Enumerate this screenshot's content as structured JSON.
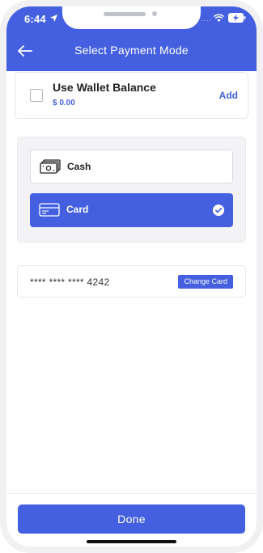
{
  "status_bar": {
    "time": "6:44",
    "icons": [
      "location-arrow-icon",
      "wifi-icon",
      "battery-charging-icon"
    ]
  },
  "header": {
    "title": "Select Payment Mode",
    "back_icon": "arrow-left-icon"
  },
  "wallet": {
    "label": "Use Wallet Balance",
    "amount": "$ 0.00",
    "add_label": "Add",
    "checked": false
  },
  "payment_methods": [
    {
      "label": "Cash",
      "icon": "cash-icon",
      "selected": false
    },
    {
      "label": "Card",
      "icon": "credit-card-icon",
      "selected": true
    }
  ],
  "saved_card": {
    "number": "**** **** **** 4242",
    "change_label": "Change Card"
  },
  "footer": {
    "done_label": "Done"
  },
  "colors": {
    "accent": "#4460e0",
    "panel_bg": "#f3f3f5",
    "text_dark": "#222222"
  }
}
